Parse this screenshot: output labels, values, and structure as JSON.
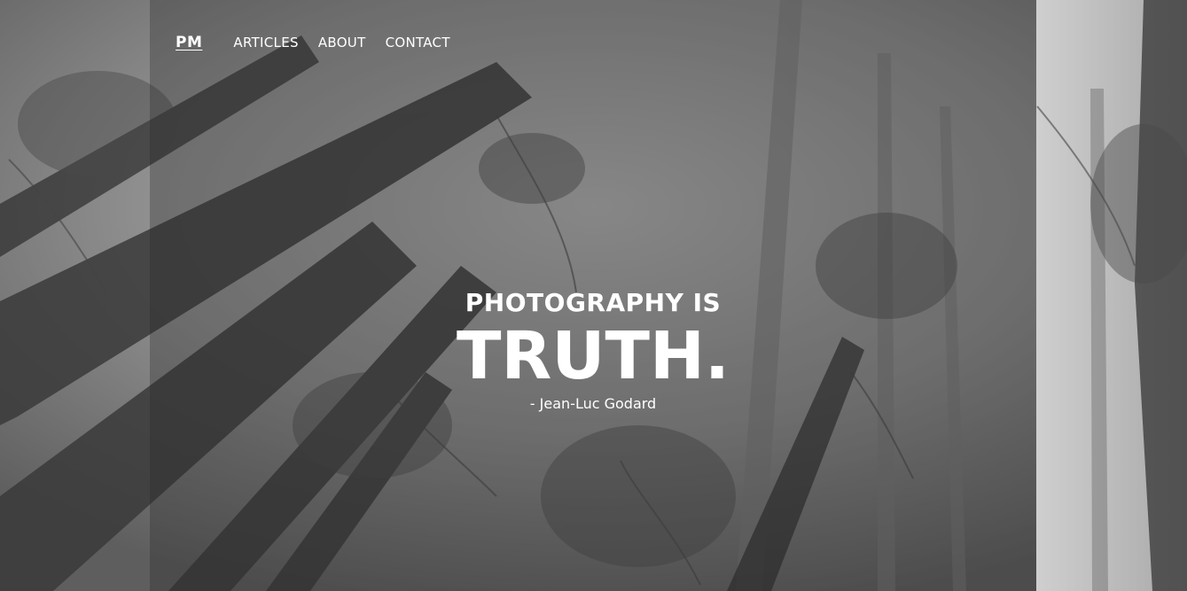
{
  "nav": {
    "brand": "PM",
    "links": [
      {
        "label": "ARTICLES"
      },
      {
        "label": "ABOUT"
      },
      {
        "label": "CONTACT"
      }
    ]
  },
  "hero": {
    "line1": "PHOTOGRAPHY IS",
    "line2": "TRUTH.",
    "attribution": "- Jean-Luc Godard",
    "background_image": "foggy-forest-trees-looking-up"
  },
  "colors": {
    "text": "#ffffff",
    "panel_overlay": "#282828",
    "fog": "#9a9a9a"
  }
}
